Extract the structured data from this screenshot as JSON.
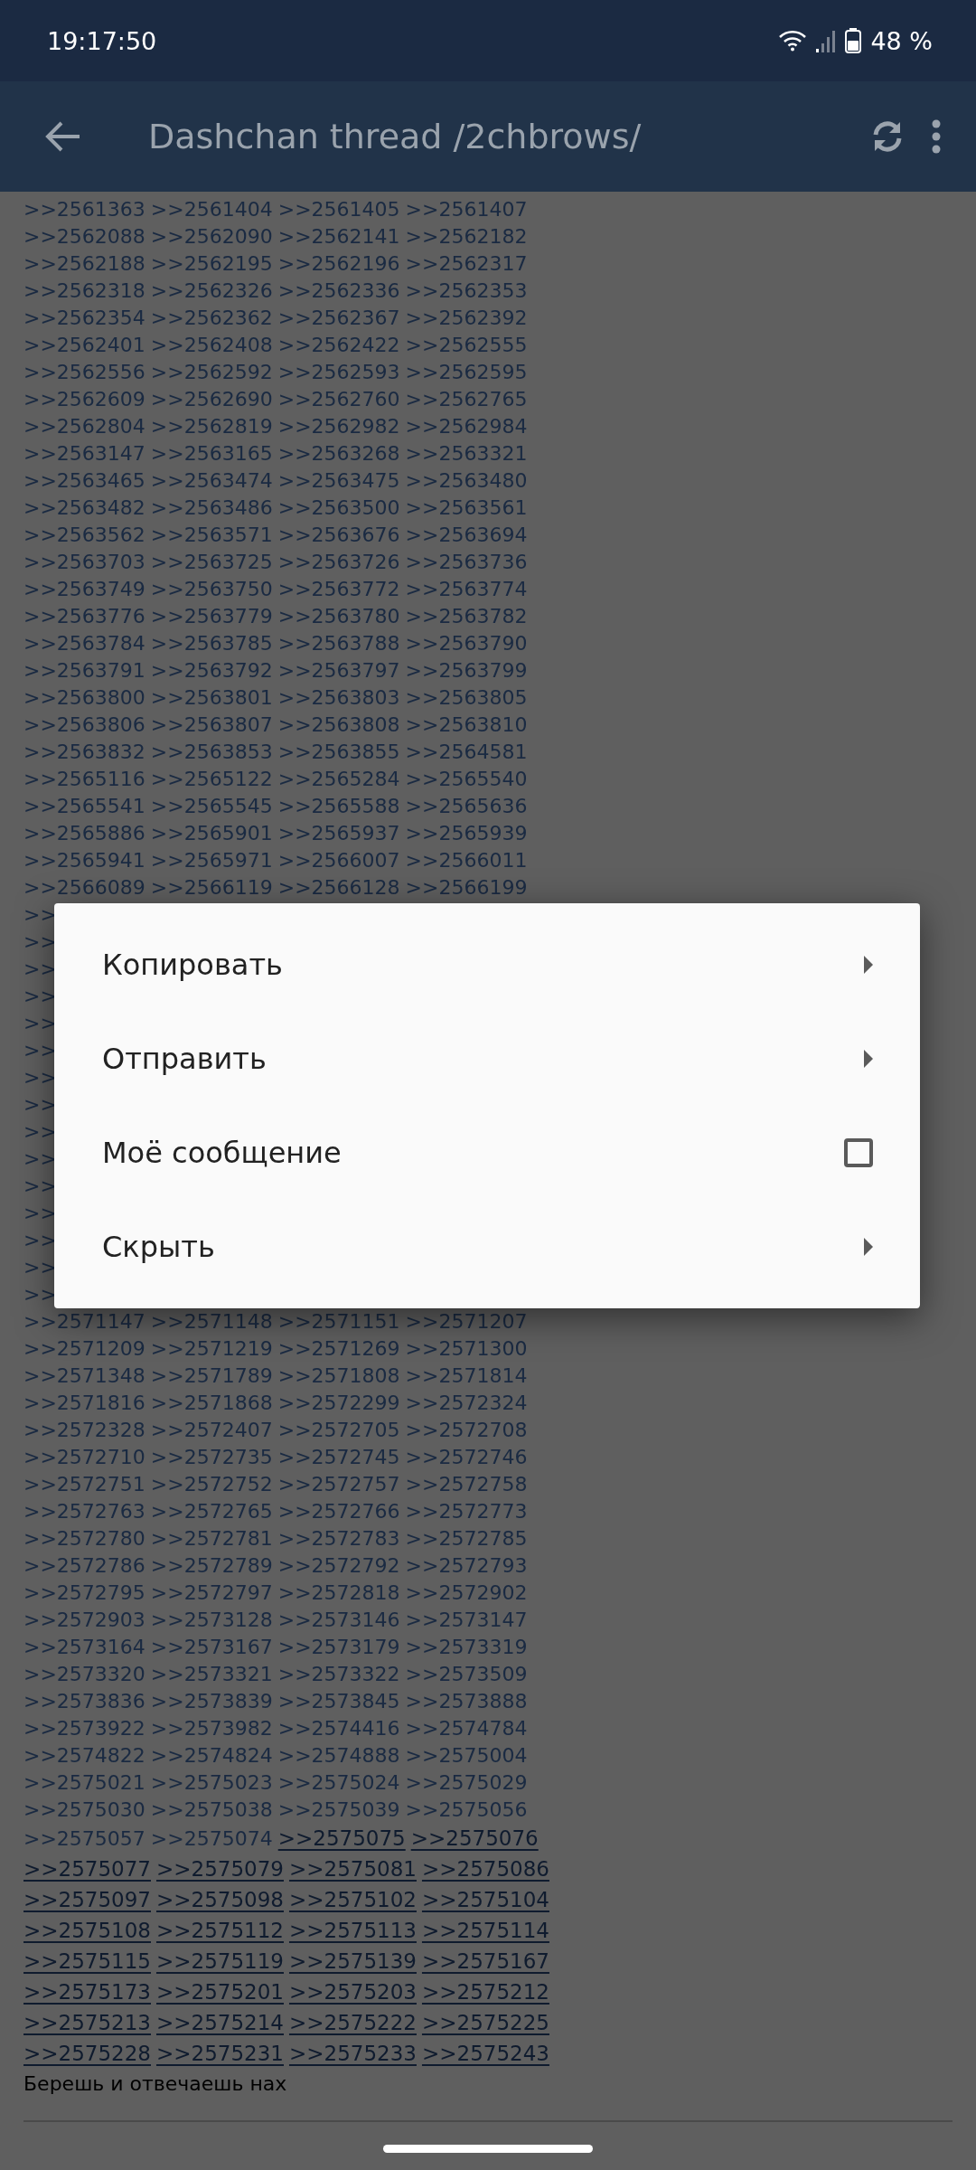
{
  "status_bar": {
    "time": "19:17:50",
    "battery": "48 %"
  },
  "app_bar": {
    "title": "Dashchan thread /2chbrows/"
  },
  "thread": {
    "rows": [
      {
        "items": [
          {
            "text": ">>2561363",
            "kind": "plain"
          },
          {
            "text": ">>2561404",
            "kind": "plain"
          },
          {
            "text": ">>2561405",
            "kind": "plain"
          },
          {
            "text": ">>2561407",
            "kind": "plain"
          }
        ]
      },
      {
        "items": [
          {
            "text": ">>2562088",
            "kind": "plain"
          },
          {
            "text": ">>2562090",
            "kind": "plain"
          },
          {
            "text": ">>2562141",
            "kind": "plain"
          },
          {
            "text": ">>2562182",
            "kind": "plain"
          }
        ]
      },
      {
        "items": [
          {
            "text": ">>2562188",
            "kind": "plain"
          },
          {
            "text": ">>2562195",
            "kind": "plain"
          },
          {
            "text": ">>2562196",
            "kind": "plain"
          },
          {
            "text": ">>2562317",
            "kind": "plain"
          }
        ]
      },
      {
        "items": [
          {
            "text": ">>2562318",
            "kind": "plain"
          },
          {
            "text": ">>2562326",
            "kind": "plain"
          },
          {
            "text": ">>2562336",
            "kind": "plain"
          },
          {
            "text": ">>2562353",
            "kind": "plain"
          }
        ]
      },
      {
        "items": [
          {
            "text": ">>2562354",
            "kind": "plain"
          },
          {
            "text": ">>2562362",
            "kind": "plain"
          },
          {
            "text": ">>2562367",
            "kind": "plain"
          },
          {
            "text": ">>2562392",
            "kind": "plain"
          }
        ]
      },
      {
        "items": [
          {
            "text": ">>2562401",
            "kind": "plain"
          },
          {
            "text": ">>2562408",
            "kind": "plain"
          },
          {
            "text": ">>2562422",
            "kind": "plain"
          },
          {
            "text": ">>2562555",
            "kind": "plain"
          }
        ]
      },
      {
        "items": [
          {
            "text": ">>2562556",
            "kind": "plain"
          },
          {
            "text": ">>2562592",
            "kind": "plain"
          },
          {
            "text": ">>2562593",
            "kind": "plain"
          },
          {
            "text": ">>2562595",
            "kind": "plain"
          }
        ]
      },
      {
        "items": [
          {
            "text": ">>2562609",
            "kind": "plain"
          },
          {
            "text": ">>2562690",
            "kind": "plain"
          },
          {
            "text": ">>2562760",
            "kind": "plain"
          },
          {
            "text": ">>2562765",
            "kind": "plain"
          }
        ]
      },
      {
        "items": [
          {
            "text": ">>2562804",
            "kind": "plain"
          },
          {
            "text": ">>2562819",
            "kind": "plain"
          },
          {
            "text": ">>2562982",
            "kind": "plain"
          },
          {
            "text": ">>2562984",
            "kind": "plain"
          }
        ]
      },
      {
        "items": [
          {
            "text": ">>2563147",
            "kind": "plain"
          },
          {
            "text": ">>2563165",
            "kind": "plain"
          },
          {
            "text": ">>2563268",
            "kind": "plain"
          },
          {
            "text": ">>2563321",
            "kind": "plain"
          }
        ]
      },
      {
        "items": [
          {
            "text": ">>2563465",
            "kind": "plain"
          },
          {
            "text": ">>2563474",
            "kind": "plain"
          },
          {
            "text": ">>2563475",
            "kind": "plain"
          },
          {
            "text": ">>2563480",
            "kind": "plain"
          }
        ]
      },
      {
        "items": [
          {
            "text": ">>2563482",
            "kind": "plain"
          },
          {
            "text": ">>2563486",
            "kind": "plain"
          },
          {
            "text": ">>2563500",
            "kind": "plain"
          },
          {
            "text": ">>2563561",
            "kind": "plain"
          }
        ]
      },
      {
        "items": [
          {
            "text": ">>2563562",
            "kind": "plain"
          },
          {
            "text": ">>2563571",
            "kind": "plain"
          },
          {
            "text": ">>2563676",
            "kind": "plain"
          },
          {
            "text": ">>2563694",
            "kind": "plain"
          }
        ]
      },
      {
        "items": [
          {
            "text": ">>2563703",
            "kind": "plain"
          },
          {
            "text": ">>2563725",
            "kind": "plain"
          },
          {
            "text": ">>2563726",
            "kind": "plain"
          },
          {
            "text": ">>2563736",
            "kind": "plain"
          }
        ]
      },
      {
        "items": [
          {
            "text": ">>2563749",
            "kind": "plain"
          },
          {
            "text": ">>2563750",
            "kind": "plain"
          },
          {
            "text": ">>2563772",
            "kind": "plain"
          },
          {
            "text": ">>2563774",
            "kind": "plain"
          }
        ]
      },
      {
        "items": [
          {
            "text": ">>2563776",
            "kind": "plain"
          },
          {
            "text": ">>2563779",
            "kind": "plain"
          },
          {
            "text": ">>2563780",
            "kind": "plain"
          },
          {
            "text": ">>2563782",
            "kind": "plain"
          }
        ]
      },
      {
        "items": [
          {
            "text": ">>2563784",
            "kind": "plain"
          },
          {
            "text": ">>2563785",
            "kind": "plain"
          },
          {
            "text": ">>2563788",
            "kind": "plain"
          },
          {
            "text": ">>2563790",
            "kind": "plain"
          }
        ]
      },
      {
        "items": [
          {
            "text": ">>2563791",
            "kind": "plain"
          },
          {
            "text": ">>2563792",
            "kind": "plain"
          },
          {
            "text": ">>2563797",
            "kind": "plain"
          },
          {
            "text": ">>2563799",
            "kind": "plain"
          }
        ]
      },
      {
        "items": [
          {
            "text": ">>2563800",
            "kind": "plain"
          },
          {
            "text": ">>2563801",
            "kind": "plain"
          },
          {
            "text": ">>2563803",
            "kind": "plain"
          },
          {
            "text": ">>2563805",
            "kind": "plain"
          }
        ]
      },
      {
        "items": [
          {
            "text": ">>2563806",
            "kind": "plain"
          },
          {
            "text": ">>2563807",
            "kind": "plain"
          },
          {
            "text": ">>2563808",
            "kind": "plain"
          },
          {
            "text": ">>2563810",
            "kind": "plain"
          }
        ]
      },
      {
        "items": [
          {
            "text": ">>2563832",
            "kind": "plain"
          },
          {
            "text": ">>2563853",
            "kind": "plain"
          },
          {
            "text": ">>2563855",
            "kind": "plain"
          },
          {
            "text": ">>2564581",
            "kind": "plain"
          }
        ]
      },
      {
        "items": [
          {
            "text": ">>2565116",
            "kind": "plain"
          },
          {
            "text": ">>2565122",
            "kind": "plain"
          },
          {
            "text": ">>2565284",
            "kind": "plain"
          },
          {
            "text": ">>2565540",
            "kind": "plain"
          }
        ]
      },
      {
        "items": [
          {
            "text": ">>2565541",
            "kind": "plain"
          },
          {
            "text": ">>2565545",
            "kind": "plain"
          },
          {
            "text": ">>2565588",
            "kind": "plain"
          },
          {
            "text": ">>2565636",
            "kind": "plain"
          }
        ]
      },
      {
        "items": [
          {
            "text": ">>2565886",
            "kind": "plain"
          },
          {
            "text": ">>2565901",
            "kind": "plain"
          },
          {
            "text": ">>2565937",
            "kind": "plain"
          },
          {
            "text": ">>2565939",
            "kind": "plain"
          }
        ]
      },
      {
        "items": [
          {
            "text": ">>2565941",
            "kind": "plain"
          },
          {
            "text": ">>2565971",
            "kind": "plain"
          },
          {
            "text": ">>2566007",
            "kind": "plain"
          },
          {
            "text": ">>2566011",
            "kind": "plain"
          }
        ]
      },
      {
        "items": [
          {
            "text": ">>2566089",
            "kind": "plain"
          },
          {
            "text": ">>2566119",
            "kind": "plain"
          },
          {
            "text": ">>2566128",
            "kind": "plain"
          },
          {
            "text": ">>2566199",
            "kind": "plain"
          }
        ]
      },
      {
        "items": [
          {
            "text": ">>",
            "kind": "plain"
          }
        ]
      },
      {
        "items": [
          {
            "text": ">>",
            "kind": "plain"
          }
        ]
      },
      {
        "items": [
          {
            "text": ">>",
            "kind": "plain"
          }
        ]
      },
      {
        "items": [
          {
            "text": ">>",
            "kind": "plain"
          }
        ]
      },
      {
        "items": [
          {
            "text": ">>",
            "kind": "plain"
          }
        ]
      },
      {
        "items": [
          {
            "text": ">>",
            "kind": "plain"
          }
        ]
      },
      {
        "items": [
          {
            "text": ">>",
            "kind": "plain"
          }
        ]
      },
      {
        "items": [
          {
            "text": ">>",
            "kind": "plain"
          }
        ]
      },
      {
        "items": [
          {
            "text": ">>",
            "kind": "plain"
          }
        ]
      },
      {
        "items": [
          {
            "text": ">>",
            "kind": "plain"
          }
        ]
      },
      {
        "items": [
          {
            "text": ">>",
            "kind": "plain"
          }
        ]
      },
      {
        "items": [
          {
            "text": ">>",
            "kind": "plain"
          }
        ]
      },
      {
        "items": [
          {
            "text": ">>",
            "kind": "plain"
          }
        ]
      },
      {
        "items": [
          {
            "text": ">>",
            "kind": "plain"
          }
        ]
      },
      {
        "items": [
          {
            "text": ">>",
            "kind": "plain"
          }
        ]
      },
      {
        "items": [
          {
            "text": ">>2571147",
            "kind": "plain"
          },
          {
            "text": ">>2571148",
            "kind": "plain"
          },
          {
            "text": ">>2571151",
            "kind": "plain"
          },
          {
            "text": ">>2571207",
            "kind": "plain"
          }
        ]
      },
      {
        "items": [
          {
            "text": ">>2571209",
            "kind": "plain"
          },
          {
            "text": ">>2571219",
            "kind": "plain"
          },
          {
            "text": ">>2571269",
            "kind": "plain"
          },
          {
            "text": ">>2571300",
            "kind": "plain"
          }
        ]
      },
      {
        "items": [
          {
            "text": ">>2571348",
            "kind": "plain"
          },
          {
            "text": ">>2571789",
            "kind": "plain"
          },
          {
            "text": ">>2571808",
            "kind": "plain"
          },
          {
            "text": ">>2571814",
            "kind": "plain"
          }
        ]
      },
      {
        "items": [
          {
            "text": ">>2571816",
            "kind": "plain"
          },
          {
            "text": ">>2571868",
            "kind": "plain"
          },
          {
            "text": ">>2572299",
            "kind": "plain"
          },
          {
            "text": ">>2572324",
            "kind": "plain"
          }
        ]
      },
      {
        "items": [
          {
            "text": ">>2572328",
            "kind": "plain"
          },
          {
            "text": ">>2572407",
            "kind": "plain"
          },
          {
            "text": ">>2572705",
            "kind": "plain"
          },
          {
            "text": ">>2572708",
            "kind": "plain"
          }
        ]
      },
      {
        "items": [
          {
            "text": ">>2572710",
            "kind": "plain"
          },
          {
            "text": ">>2572735",
            "kind": "plain"
          },
          {
            "text": ">>2572745",
            "kind": "plain"
          },
          {
            "text": ">>2572746",
            "kind": "plain"
          }
        ]
      },
      {
        "items": [
          {
            "text": ">>2572751",
            "kind": "plain"
          },
          {
            "text": ">>2572752",
            "kind": "plain"
          },
          {
            "text": ">>2572757",
            "kind": "plain"
          },
          {
            "text": ">>2572758",
            "kind": "plain"
          }
        ]
      },
      {
        "items": [
          {
            "text": ">>2572763",
            "kind": "plain"
          },
          {
            "text": ">>2572765",
            "kind": "plain"
          },
          {
            "text": ">>2572766",
            "kind": "plain"
          },
          {
            "text": ">>2572773",
            "kind": "plain"
          }
        ]
      },
      {
        "items": [
          {
            "text": ">>2572780",
            "kind": "plain"
          },
          {
            "text": ">>2572781",
            "kind": "plain"
          },
          {
            "text": ">>2572783",
            "kind": "plain"
          },
          {
            "text": ">>2572785",
            "kind": "plain"
          }
        ]
      },
      {
        "items": [
          {
            "text": ">>2572786",
            "kind": "plain"
          },
          {
            "text": ">>2572789",
            "kind": "plain"
          },
          {
            "text": ">>2572792",
            "kind": "plain"
          },
          {
            "text": ">>2572793",
            "kind": "plain"
          }
        ]
      },
      {
        "items": [
          {
            "text": ">>2572795",
            "kind": "plain"
          },
          {
            "text": ">>2572797",
            "kind": "plain"
          },
          {
            "text": ">>2572818",
            "kind": "plain"
          },
          {
            "text": ">>2572902",
            "kind": "plain"
          }
        ]
      },
      {
        "items": [
          {
            "text": ">>2572903",
            "kind": "plain"
          },
          {
            "text": ">>2573128",
            "kind": "plain"
          },
          {
            "text": ">>2573146",
            "kind": "plain"
          },
          {
            "text": ">>2573147",
            "kind": "plain"
          }
        ]
      },
      {
        "items": [
          {
            "text": ">>2573164",
            "kind": "plain"
          },
          {
            "text": ">>2573167",
            "kind": "plain"
          },
          {
            "text": ">>2573179",
            "kind": "plain"
          },
          {
            "text": ">>2573319",
            "kind": "plain"
          }
        ]
      },
      {
        "items": [
          {
            "text": ">>2573320",
            "kind": "plain"
          },
          {
            "text": ">>2573321",
            "kind": "plain"
          },
          {
            "text": ">>2573322",
            "kind": "plain"
          },
          {
            "text": ">>2573509",
            "kind": "plain"
          }
        ]
      },
      {
        "items": [
          {
            "text": ">>2573836",
            "kind": "plain"
          },
          {
            "text": ">>2573839",
            "kind": "plain"
          },
          {
            "text": ">>2573845",
            "kind": "plain"
          },
          {
            "text": ">>2573888",
            "kind": "plain"
          }
        ]
      },
      {
        "items": [
          {
            "text": ">>2573922",
            "kind": "plain"
          },
          {
            "text": ">>2573982",
            "kind": "plain"
          },
          {
            "text": ">>2574416",
            "kind": "plain"
          },
          {
            "text": ">>2574784",
            "kind": "plain"
          }
        ]
      },
      {
        "items": [
          {
            "text": ">>2574822",
            "kind": "plain"
          },
          {
            "text": ">>2574824",
            "kind": "plain"
          },
          {
            "text": ">>2574888",
            "kind": "plain"
          },
          {
            "text": ">>2575004",
            "kind": "plain"
          }
        ]
      },
      {
        "items": [
          {
            "text": ">>2575021",
            "kind": "plain"
          },
          {
            "text": ">>2575023",
            "kind": "plain"
          },
          {
            "text": ">>2575024",
            "kind": "plain"
          },
          {
            "text": ">>2575029",
            "kind": "plain"
          }
        ]
      },
      {
        "items": [
          {
            "text": ">>2575030",
            "kind": "plain"
          },
          {
            "text": ">>2575038",
            "kind": "plain"
          },
          {
            "text": ">>2575039",
            "kind": "plain"
          },
          {
            "text": ">>2575056",
            "kind": "plain"
          }
        ]
      },
      {
        "items": [
          {
            "text": ">>2575057",
            "kind": "plain"
          },
          {
            "text": ">>2575074",
            "kind": "plain"
          },
          {
            "text": ">>2575075",
            "kind": "link"
          },
          {
            "text": ">>2575076",
            "kind": "link"
          }
        ]
      },
      {
        "items": [
          {
            "text": ">>2575077",
            "kind": "link"
          },
          {
            "text": ">>2575079",
            "kind": "link"
          },
          {
            "text": ">>2575081",
            "kind": "link"
          },
          {
            "text": ">>2575086",
            "kind": "link"
          }
        ]
      },
      {
        "items": [
          {
            "text": ">>2575097",
            "kind": "link"
          },
          {
            "text": ">>2575098",
            "kind": "link"
          },
          {
            "text": ">>2575102",
            "kind": "link"
          },
          {
            "text": ">>2575104",
            "kind": "link"
          }
        ]
      },
      {
        "items": [
          {
            "text": ">>2575108",
            "kind": "link"
          },
          {
            "text": ">>2575112",
            "kind": "link"
          },
          {
            "text": ">>2575113",
            "kind": "link"
          },
          {
            "text": ">>2575114",
            "kind": "link"
          }
        ]
      },
      {
        "items": [
          {
            "text": ">>2575115",
            "kind": "link"
          },
          {
            "text": ">>2575119",
            "kind": "link"
          },
          {
            "text": ">>2575139",
            "kind": "link"
          },
          {
            "text": ">>2575167",
            "kind": "link"
          }
        ]
      },
      {
        "items": [
          {
            "text": ">>2575173",
            "kind": "link"
          },
          {
            "text": ">>2575201",
            "kind": "link"
          },
          {
            "text": ">>2575203",
            "kind": "link"
          },
          {
            "text": ">>2575212",
            "kind": "link"
          }
        ]
      },
      {
        "items": [
          {
            "text": ">>2575213",
            "kind": "link"
          },
          {
            "text": ">>2575214",
            "kind": "link"
          },
          {
            "text": ">>2575222",
            "kind": "link"
          },
          {
            "text": ">>2575225",
            "kind": "link"
          }
        ]
      },
      {
        "items": [
          {
            "text": ">>2575228",
            "kind": "link"
          },
          {
            "text": ">>2575231",
            "kind": "link"
          },
          {
            "text": ">>2575233",
            "kind": "link"
          },
          {
            "text": ">>2575243",
            "kind": "link"
          }
        ]
      }
    ],
    "comment": "Берешь и отвечаешь нах"
  },
  "menu": {
    "items": [
      {
        "label": "Копировать",
        "kind": "submenu"
      },
      {
        "label": "Отправить",
        "kind": "submenu"
      },
      {
        "label": "Моё сообщение",
        "kind": "checkbox",
        "checked": false
      },
      {
        "label": "Скрыть",
        "kind": "submenu"
      }
    ]
  }
}
